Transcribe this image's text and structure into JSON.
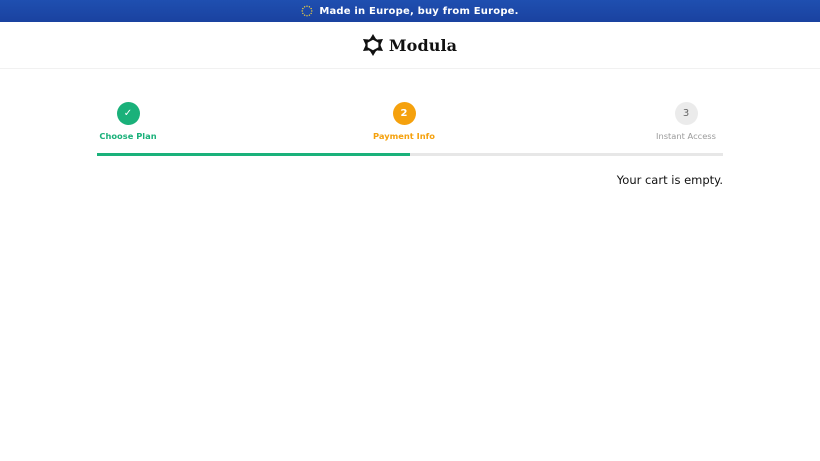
{
  "banner": {
    "text": "Made in Europe, buy from Europe.",
    "icon": "eu-flag-icon",
    "background_color": "#1f4fb0"
  },
  "header": {
    "logo_icon": "modula-logo-icon",
    "logo_text": "Modula"
  },
  "steps": [
    {
      "number": "✓",
      "label": "Choose Plan",
      "state": "done",
      "color": "#1ab17a"
    },
    {
      "number": "2",
      "label": "Payment Info",
      "state": "current",
      "color": "#f5a10d"
    },
    {
      "number": "3",
      "label": "Instant Access",
      "state": "pending",
      "color": "#9a9a9a"
    }
  ],
  "progress": {
    "fraction": 0.5,
    "fill_color": "#1ab17a",
    "track_color": "#e7e7e7"
  },
  "cart": {
    "message": "Your cart is empty."
  }
}
